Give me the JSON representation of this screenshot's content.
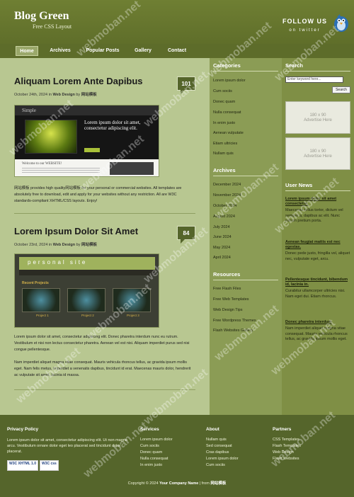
{
  "header": {
    "site_title": "Blog Green",
    "tagline": "Free CSS Layout",
    "follow_line1": "FOLLOW US",
    "follow_line2": "on twitter"
  },
  "nav": {
    "items": [
      "Home",
      "Archives",
      "Popular Posts",
      "Gallery",
      "Contact"
    ],
    "active": "Home"
  },
  "posts": [
    {
      "title": "Aliquam Lorem Ante Dapibus",
      "date": "October 24th, 2024",
      "in_label": "in",
      "category": "Web Design",
      "by_label": "by",
      "author": "网站模板",
      "comments": "101",
      "thumb": {
        "logo": "Simple",
        "headline": "Lorem ipsum dolor sit amet, consectetur adipiscing elit.",
        "welcome": "Welcome to our WEBSITE!"
      },
      "body": "网站模板 provides high quality网站模板 for your personal or commercial websites. All templates are absolutely free to download, edit and apply for your websites without any restriction. All are W3C standards-compliant XHTML/CSS layouts. Enjoy!"
    },
    {
      "title": "Lorem Ipsum Dolor Sit Amet",
      "date": "October 23rd, 2024",
      "in_label": "in",
      "category": "Web Design",
      "by_label": "by",
      "author": "网站模板",
      "comments": "84",
      "thumb": {
        "title": "personal site",
        "section": "Recent Projects",
        "cards": [
          "Project 1",
          "Project 2",
          "Project 3"
        ]
      },
      "body1": "Lorem ipsum dolor sit amet, consectetur adipiscing elit. Donec pharetra interdum nunc eu rutrum. Vestibulum et nisi non lectus consectetur pharetra. Aenean vel est nisi. Aliquam imperdiet purus sed nisi congue pellentesque.",
      "body2": "Nam imperdiet aliquet magna vitae consequat. Mauris vehicula rhoncus tellus, ac gravida ipsum mollis eget. Nam felis metus, imperdiet a venenatis dapibus, tincidunt id erat. Maecenas mauris dolor, hendrerit ac vulputate sit amet, lacinia id massa."
    }
  ],
  "sidebar_mid": {
    "categories_title": "Categories",
    "categories": [
      "Lorem ipsum dolor",
      "Cum sociis",
      "Donec quam",
      "Nulla consequat",
      "In enim justo",
      "Aenean vulputate",
      "Etiam ultricies",
      "Nullam quis"
    ],
    "archives_title": "Archives",
    "archives": [
      "December 2024",
      "November 2024",
      "October 2024",
      "August 2024",
      "July 2024",
      "June 2024",
      "May 2024",
      "April 2024"
    ],
    "resources_title": "Resources",
    "resources": [
      "Free Flash Files",
      "Free Web Templates",
      "Web Design Tips",
      "Free Wordpress Themes",
      "Flash Websites Gallery"
    ]
  },
  "sidebar_right": {
    "search_title": "Search",
    "search_placeholder": "Enter keyword here...",
    "search_button": "Search",
    "ad_text1": "180 x 90",
    "ad_text2": "Advertise Here",
    "news_title": "User News",
    "news": [
      {
        "title": "Lorem ipsum dolor sit amet consectetur.",
        "text": "Maecenas tellus tortor, dictum vel semper a, dapibus ac elit. Nunc rutrum pretium porta."
      },
      {
        "title": "Aenean feugiat mattis est nec egestas.",
        "text": "Donec pede justo, fringilla vel, aliquet nec, vulputate eget, arcu."
      },
      {
        "title": "Pellentesque tincidunt, bibendum id, lacinia in.",
        "text": "Curabitur ullamcorper ultricies nisi. Nam eget dui. Etiam rhoncus."
      },
      {
        "title": "Donec pharetra interdum",
        "text": "Nam imperdiet aliquet magna vitae consequat. Mauris vehicula rhoncus tellus, ac gravida ipsum mollis eget."
      }
    ]
  },
  "footer": {
    "privacy_title": "Privacy Policy",
    "privacy_text": "Lorem ipsum dolor sit amet, consectetur adipiscing elit. Ut non magna arcu. Vestibulum ornare dolor eget leo placerat sed tincidunt dolor placerat.",
    "badge_xhtml": "W3C XHTML 1.0",
    "badge_css": "W3C css",
    "services_title": "Services",
    "services": [
      "Lorem ipsum dolor",
      "Cum sociis",
      "Donec quam",
      "Nulla consequat",
      "In enim justo"
    ],
    "about_title": "About",
    "about": [
      "Nullam quis",
      "Sed consequat",
      "Cras dapibus",
      "Lorem ipsum dolor",
      "Cum sociis"
    ],
    "partners_title": "Partners",
    "partners": [
      "CSS Templates",
      "Flash Templates",
      "Web Design",
      "Flash Websites"
    ],
    "copyright_prefix": "Copyright © 2024",
    "company": "Your Company Name",
    "copyright_from": "| from",
    "from_site": "网站模板"
  },
  "watermark": "webmoban.net",
  "colors": {
    "page_bg": "#5b6b2c",
    "main_bg": "#b8c791",
    "mid_sidebar_bg": "#8b9c55",
    "right_sidebar_bg": "#7f8f45",
    "footer_bg": "#55652b",
    "badge_bg": "#55652b"
  }
}
